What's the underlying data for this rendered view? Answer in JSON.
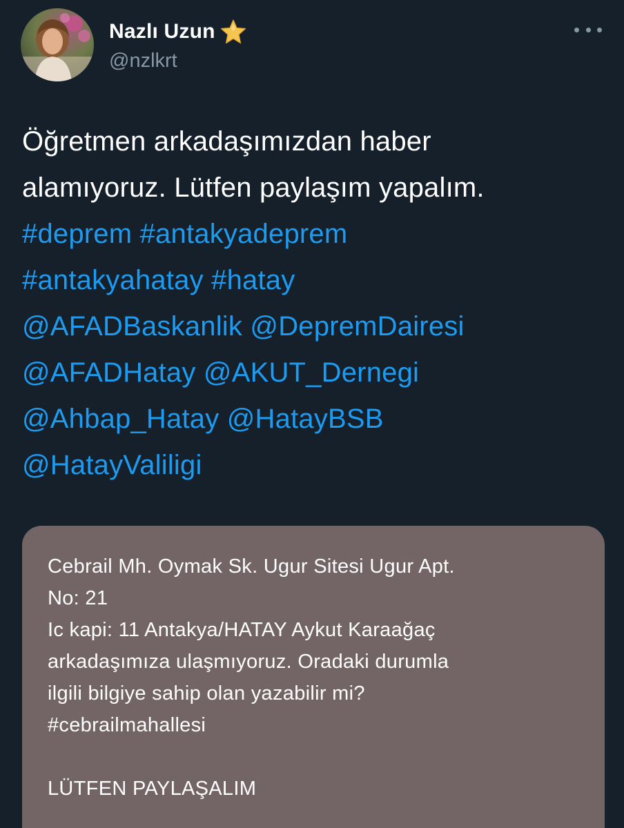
{
  "author": {
    "display_name": "Nazlı Uzun",
    "handle": "@nzlkrt",
    "badge_icon": "star-icon",
    "avatar_icon": "avatar-photo"
  },
  "menu": {
    "icon": "more-icon"
  },
  "tweet": {
    "text_line1": "Öğretmen arkadaşımızdan haber",
    "text_line2": "alamıyoruz. Lütfen paylaşım yapalım.",
    "hashtags": [
      "#deprem",
      "#antakyadeprem",
      "#antakyahatay",
      "#hatay"
    ],
    "mentions": [
      "@AFADBaskanlik",
      "@DepremDairesi",
      "@AFADHatay",
      "@AKUT_Dernegi",
      "@Ahbap_Hatay",
      "@HatayBSB",
      "@HatayValiligi"
    ]
  },
  "media": {
    "lines": [
      "Cebrail Mh. Oymak Sk. Ugur Sitesi Ugur Apt.",
      "No: 21",
      "Ic kapi: 11 Antakya/HATAY Aykut Karaağaç",
      "arkadaşımıza ulaşmıyoruz. Oradaki durumla",
      "ilgili bilgiye sahip olan yazabilir mi?",
      "#cebrailmahallesi"
    ],
    "footer": "LÜTFEN PAYLAŞALIM"
  },
  "colors": {
    "background": "#15202b",
    "link": "#1d9bf0",
    "secondary_text": "#8899a6",
    "media_background": "#736466",
    "star": "#f5c451"
  }
}
